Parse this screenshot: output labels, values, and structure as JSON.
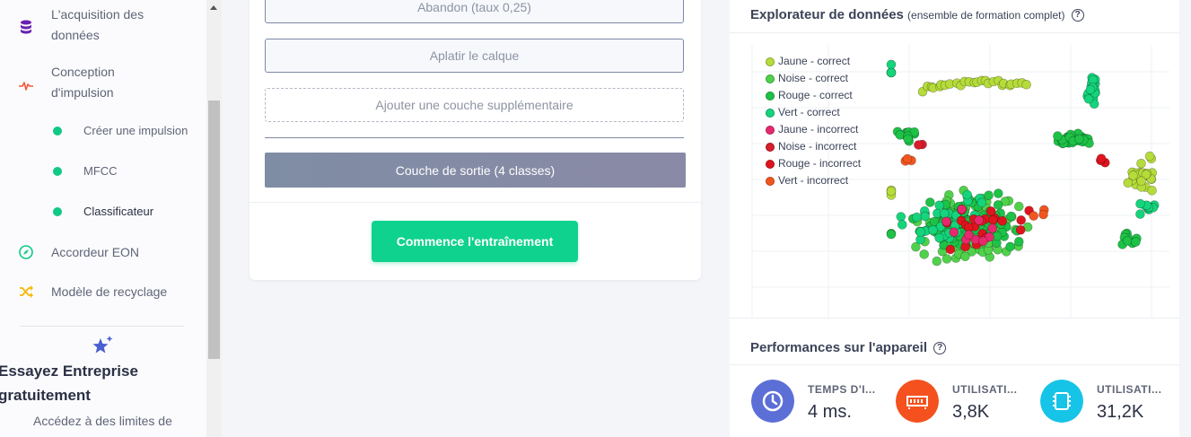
{
  "sidebar": {
    "items": [
      {
        "label_lines": [
          "L'acquisition des",
          "données"
        ],
        "icon": "database-icon",
        "color": "#6a1fb0"
      },
      {
        "label_lines": [
          "Conception",
          "d'impulsion"
        ],
        "icon": "pulse-icon",
        "color": "#f15a3b"
      }
    ],
    "subitems": [
      {
        "label": "Créer une impulsion"
      },
      {
        "label": "MFCC"
      },
      {
        "label": "Classificateur"
      }
    ],
    "bottom_items": [
      {
        "label": "Accordeur EON",
        "icon": "compass-icon",
        "color": "#10c984"
      },
      {
        "label": "Modèle de recyclage",
        "icon": "shuffle-icon",
        "color": "#f5b800"
      }
    ],
    "promo": {
      "title": "Essayez Entreprise gratuitement",
      "text": "Accédez à des limites de"
    }
  },
  "main": {
    "layers": [
      {
        "label": "Abandon (taux 0,25)"
      },
      {
        "label": "Aplatir le calque"
      }
    ],
    "add_layer": "Ajouter une couche supplémentaire",
    "output_layer": "Couche de sortie (4 classes)",
    "train_button": "Commence l'entraînement"
  },
  "explorer": {
    "title": "Explorateur de données",
    "subtitle": "(ensemble de formation complet)",
    "help": "?"
  },
  "chart_data": {
    "type": "scatter",
    "legend_position": "top-left",
    "grid": true,
    "legend": [
      {
        "name": "Jaune - correct",
        "color": "#b5dc3a"
      },
      {
        "name": "Noise - correct",
        "color": "#4fd24a"
      },
      {
        "name": "Rouge - correct",
        "color": "#1dc247"
      },
      {
        "name": "Vert - correct",
        "color": "#14d47c"
      },
      {
        "name": "Jaune - incorrect",
        "color": "#e8286e"
      },
      {
        "name": "Noise - incorrect",
        "color": "#d81d2c"
      },
      {
        "name": "Rouge - incorrect",
        "color": "#e0141e"
      },
      {
        "name": "Vert - incorrect",
        "color": "#f2561e"
      }
    ]
  },
  "performance": {
    "title": "Performances sur l'appareil",
    "help": "?",
    "metrics": [
      {
        "label": "TEMPS D'I...",
        "value": "4 ms.",
        "icon": "clock-icon",
        "color": "#5b6fd6"
      },
      {
        "label": "UTILISATI...",
        "value": "3,8K",
        "icon": "ram-icon",
        "color": "#f4511e"
      },
      {
        "label": "UTILISATI...",
        "value": "31,2K",
        "icon": "chip-icon",
        "color": "#16c4e8"
      }
    ]
  }
}
